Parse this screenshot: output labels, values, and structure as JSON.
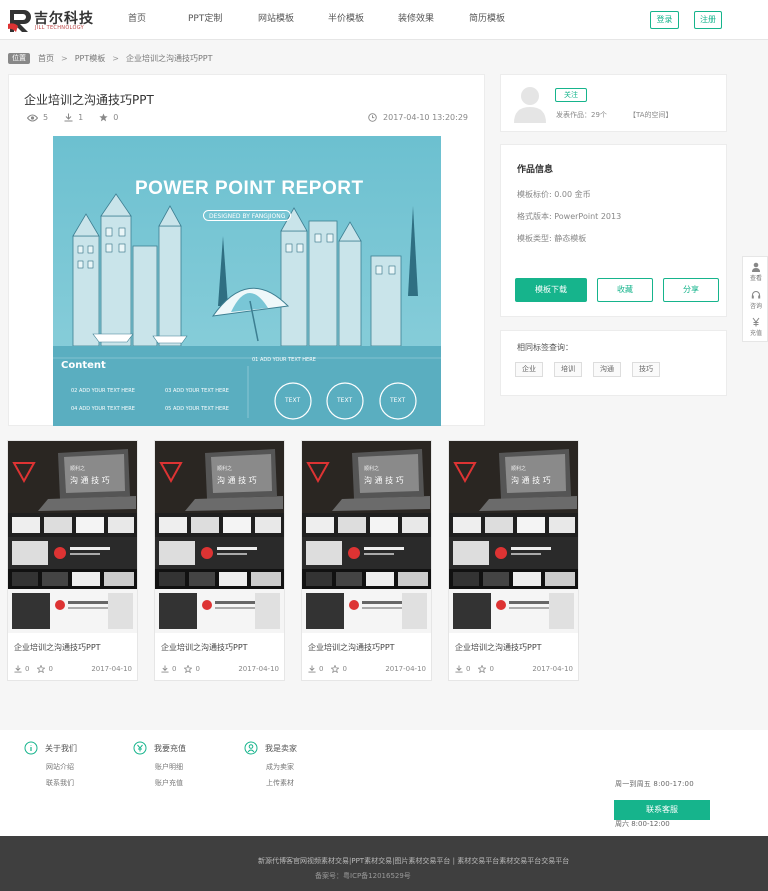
{
  "header": {
    "logo_name": "吉尔科技",
    "logo_sub": "JILL TECHNOLOGY",
    "nav": [
      "首页",
      "PPT定制",
      "网站模板",
      "半价模板",
      "装修效果",
      "简历模板"
    ],
    "login": "登录",
    "register": "注册"
  },
  "breadcrumb": {
    "badge": "位置",
    "items": [
      "首页",
      "PPT模板",
      "企业培训之沟通技巧PPT"
    ],
    "sep": ">"
  },
  "work": {
    "title": "企业培训之沟通技巧PPT",
    "views": "5",
    "downloads": "1",
    "stars": "0",
    "date": "2017-04-10 13:20:29"
  },
  "preview": {
    "heading": "POWER POINT REPORT",
    "designed_by": "DESIGNED BY FANGJIONG",
    "content_label": "Content",
    "item1": "01 ADD YOUR TEXT HERE",
    "item2": "02 ADD YOUR TEXT HERE",
    "item3": "03 ADD YOUR TEXT HERE",
    "item4": "04 ADD YOUR TEXT HERE",
    "item5": "05 ADD YOUR TEXT HERE",
    "circle": "TEXT"
  },
  "author": {
    "follow": "关注",
    "works": "发表作品：29个",
    "space": "【TA的空间】"
  },
  "info": {
    "title": "作品信息",
    "price": "模板标价: 0.00 金币",
    "format": "格式版本: PowerPoint 2013",
    "type": "模板类型: 静态模板",
    "download": "模板下载",
    "collect": "收藏",
    "share": "分享"
  },
  "tags": {
    "title": "相同标签查询：",
    "items": [
      "企业",
      "培训",
      "沟通",
      "技巧"
    ]
  },
  "side": {
    "view": "查看",
    "consult": "咨询",
    "recharge": "充值"
  },
  "related": [
    {
      "name": "企业培训之沟通技巧PPT",
      "downloads": "0",
      "stars": "0",
      "date": "2017-04-10",
      "thumb_title1": "顺利之",
      "thumb_title2": "沟 通 技 巧"
    },
    {
      "name": "企业培训之沟通技巧PPT",
      "downloads": "0",
      "stars": "0",
      "date": "2017-04-10",
      "thumb_title1": "顺利之",
      "thumb_title2": "沟 通 技 巧"
    },
    {
      "name": "企业培训之沟通技巧PPT",
      "downloads": "0",
      "stars": "0",
      "date": "2017-04-10",
      "thumb_title1": "顺利之",
      "thumb_title2": "沟 通 技 巧"
    },
    {
      "name": "企业培训之沟通技巧PPT",
      "downloads": "0",
      "stars": "0",
      "date": "2017-04-10",
      "thumb_title1": "顺利之",
      "thumb_title2": "沟 通 技 巧"
    }
  ],
  "footer": {
    "cols": [
      {
        "head": "关于我们",
        "links": [
          "网站介绍",
          "联系我们"
        ]
      },
      {
        "head": "我要充值",
        "links": [
          "账户明细",
          "账户充值"
        ]
      },
      {
        "head": "我是卖家",
        "links": [
          "成为卖家",
          "上传素材"
        ]
      }
    ],
    "hotline": "周一到周五 8:00-17:00",
    "contact": "联系客服",
    "hotline2": "周六 8:00-12:00",
    "copy1": "新源代博客官网视频素材交易|PPT素材交易|图片素材交易平台 | 素材交易平台素材交易平台交易平台",
    "copy2": "备案号：粤ICP备12016529号"
  },
  "colors": {
    "accent": "#16b48c",
    "footer_dark": "#3f3f3f"
  }
}
